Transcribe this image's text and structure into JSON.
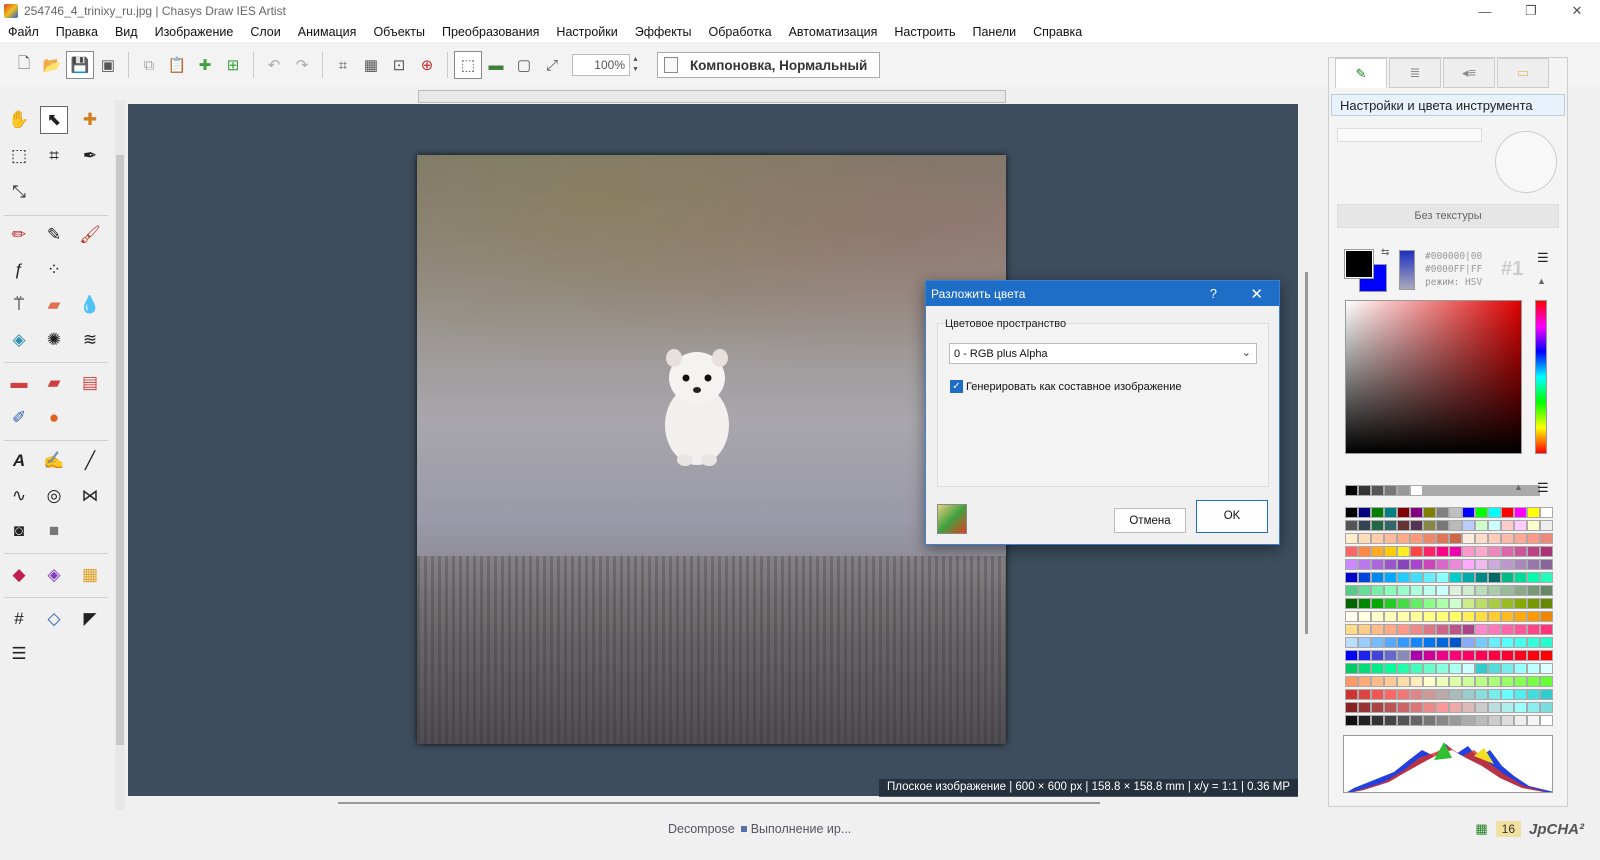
{
  "window": {
    "title": "254746_4_trinixy_ru.jpg | Chasys Draw IES Artist",
    "minimize": "—",
    "maximize": "❐",
    "close": "✕"
  },
  "menu": [
    "Файл",
    "Правка",
    "Вид",
    "Изображение",
    "Слои",
    "Анимация",
    "Объекты",
    "Преобразования",
    "Настройки",
    "Эффекты",
    "Обработка",
    "Автоматизация",
    "Настроить",
    "Панели",
    "Справка"
  ],
  "toolbar": {
    "zoom": "100%",
    "mode_label": "Компоновка, Нормальный"
  },
  "canvas": {
    "status": "Плоское изображение | 600 × 600 px | 158.8 × 158.8 mm | x/y = 1:1 | 0.36 MP"
  },
  "statusbar": {
    "task": "Decompose",
    "progress": "Выполнение ир...",
    "count": "16",
    "logo": "JpCHA²"
  },
  "right_panel": {
    "header": "Настройки и цвета инструмента",
    "texture": "Без текстуры",
    "fg_hex": "#000000|00",
    "bg_hex": "#0000FF|FF",
    "mode": "режим: HSV",
    "slot": "#1",
    "fg_color": "#000000",
    "bg_color": "#0000ff"
  },
  "dialog": {
    "title": "Разложить цвета",
    "help": "?",
    "close": "✕",
    "group_label": "Цветовое пространство",
    "colorspace": "0 - RGB plus Alpha",
    "checkbox_label": "Генерировать как составное изображение",
    "checkbox_checked": true,
    "cancel": "Отмена",
    "ok": "OK"
  }
}
